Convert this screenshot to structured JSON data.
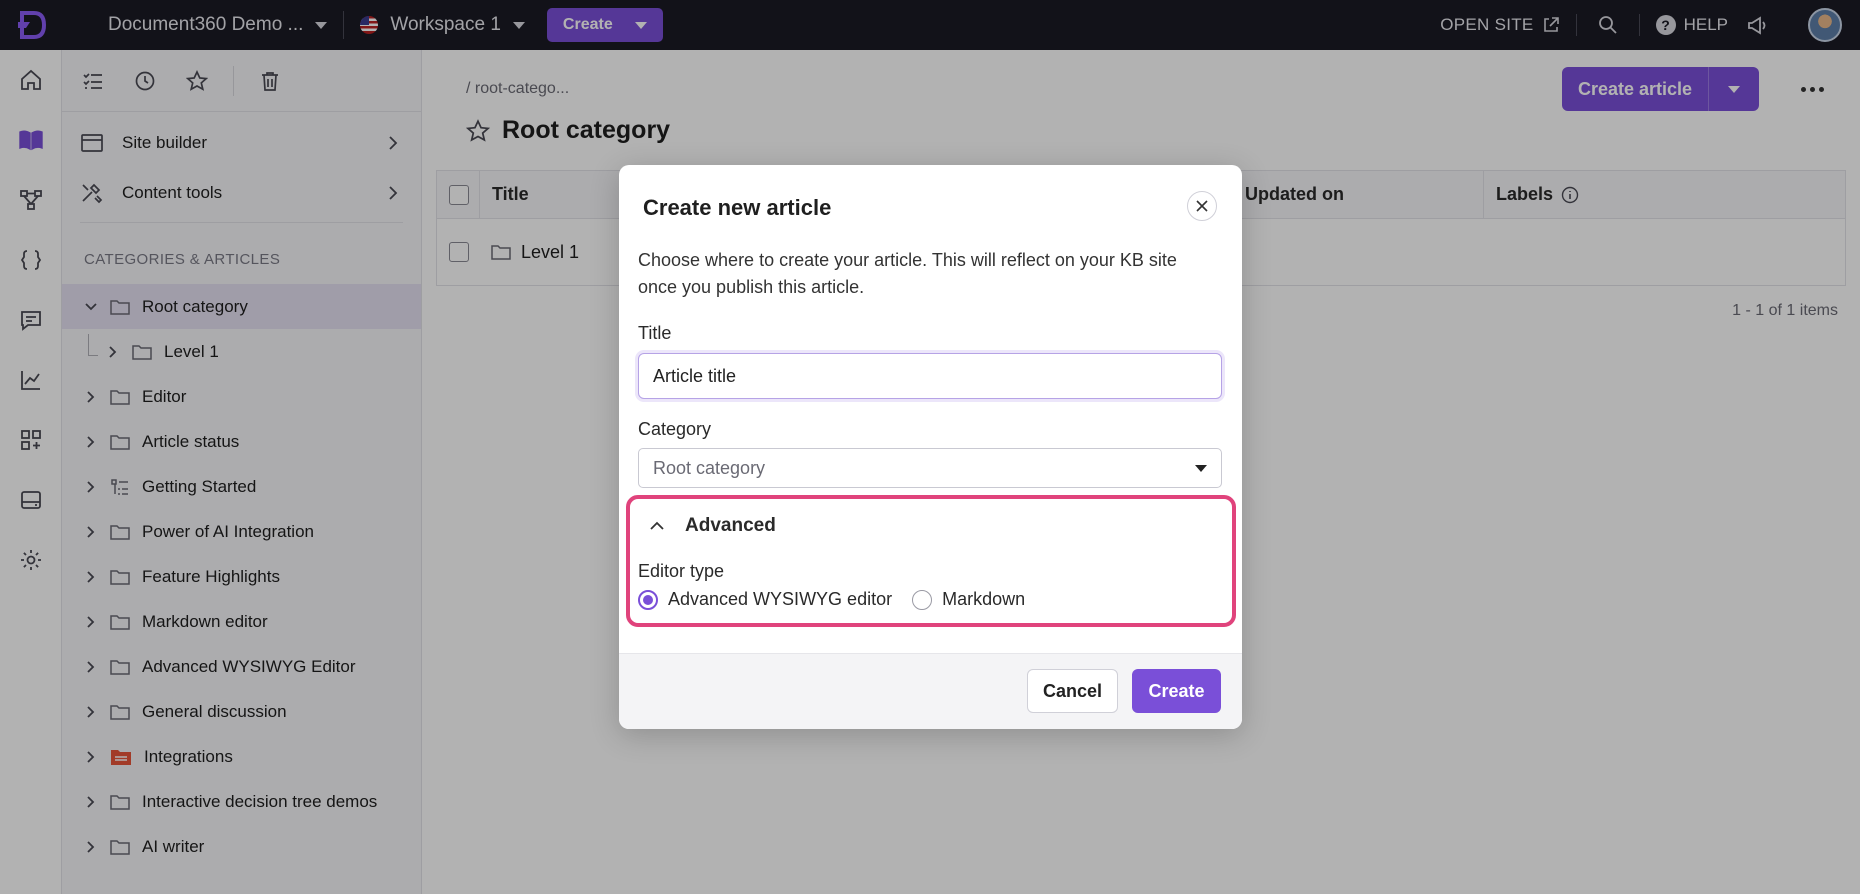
{
  "topbar": {
    "project_name": "Document360 Demo ...",
    "workspace": "Workspace 1",
    "create_label": "Create",
    "open_site_label": "OPEN SITE",
    "help_label": "HELP"
  },
  "rail": {
    "icons": [
      "home-icon",
      "book-icon",
      "workflow-icon",
      "code-braces-icon",
      "comment-icon",
      "analytics-icon",
      "apps-add-icon",
      "drive-icon",
      "settings-icon"
    ],
    "active": "book-icon"
  },
  "sidebar": {
    "links": [
      {
        "label": "Site builder"
      },
      {
        "label": "Content tools"
      }
    ],
    "heading": "CATEGORIES & ARTICLES",
    "tree": [
      {
        "label": "Root category",
        "selected": true,
        "expanded": true
      },
      {
        "label": "Level 1",
        "child": true
      },
      {
        "label": "Editor"
      },
      {
        "label": "Article status"
      },
      {
        "label": "Getting Started"
      },
      {
        "label": "Power of AI Integration"
      },
      {
        "label": "Feature Highlights"
      },
      {
        "label": "Markdown editor"
      },
      {
        "label": "Advanced WYSIWYG Editor"
      },
      {
        "label": "General discussion"
      },
      {
        "label": "Integrations"
      },
      {
        "label": "Interactive decision tree demos"
      },
      {
        "label": "AI writer"
      }
    ]
  },
  "main": {
    "breadcrumb": "/ root-catego...",
    "title": "Root category",
    "create_article_label": "Create article",
    "table": {
      "headers": [
        "Title",
        "Updated on",
        "Labels"
      ],
      "rows": [
        {
          "title": "Level 1"
        }
      ]
    },
    "pager": "1 - 1 of 1 items"
  },
  "modal": {
    "title": "Create new article",
    "description": "Choose where to create your article. This will reflect on your KB site once you publish this article.",
    "title_label": "Title",
    "title_value": "Article title",
    "category_label": "Category",
    "category_value": "Root category",
    "advanced_label": "Advanced",
    "editor_type_label": "Editor type",
    "editor_options": [
      {
        "label": "Advanced WYSIWYG editor",
        "selected": true
      },
      {
        "label": "Markdown",
        "selected": false
      }
    ],
    "cancel_label": "Cancel",
    "create_label": "Create"
  },
  "colors": {
    "accent": "#7a4fd8",
    "highlight": "#e0437c",
    "topbar": "#1a1a24"
  }
}
